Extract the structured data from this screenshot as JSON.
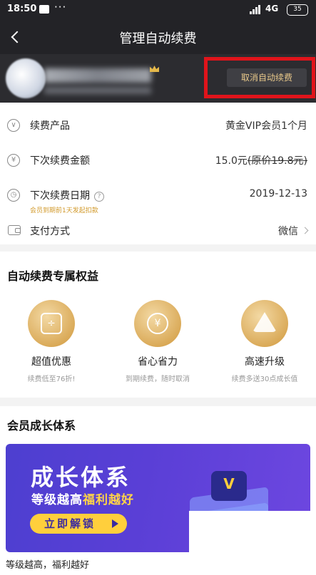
{
  "status_bar": {
    "time": "18:50",
    "dots": "···",
    "network": "4G",
    "battery": "35"
  },
  "header": {
    "title": "管理自动续费"
  },
  "user": {
    "cancel_label": "取消自动续费"
  },
  "details": [
    {
      "icon": "chevron-circle-icon",
      "label": "续费产品",
      "value": "黄金VIP会员1个月"
    },
    {
      "icon": "yen-circle-icon",
      "label": "下次续费金额",
      "value": "15.0元",
      "original": "(原价19.8元)"
    },
    {
      "icon": "clock-icon",
      "label": "下次续费日期",
      "value": "2019-12-13",
      "note": "会员到期前1天发起扣款"
    },
    {
      "icon": "wallet-icon",
      "label": "支付方式",
      "value": "微信"
    }
  ],
  "benefits_title": "自动续费专属权益",
  "benefits": [
    {
      "icon": "tag-discount-icon",
      "title": "超值优惠",
      "subtitle": "续费低至76折!"
    },
    {
      "icon": "alarm-clock-icon",
      "title": "省心省力",
      "subtitle": "到期续费，随时取消"
    },
    {
      "icon": "warning-up-icon",
      "title": "高速升级",
      "subtitle": "续费多送30点成长值"
    }
  ],
  "growth": {
    "title": "会员成长体系",
    "banner_title": "成长体系",
    "banner_sub_prefix": "等级越高",
    "banner_sub_highlight": "福利越好",
    "banner_cta": "立即解锁",
    "caption": "等级越高，福利越好"
  },
  "colors": {
    "header_bg": "#232327",
    "gold_text": "#e8c88a",
    "highlight_red": "#e0141b",
    "note_orange": "#d29a2c",
    "banner_purple": "#5a3fd6",
    "cta_yellow": "#ffcf3c"
  }
}
